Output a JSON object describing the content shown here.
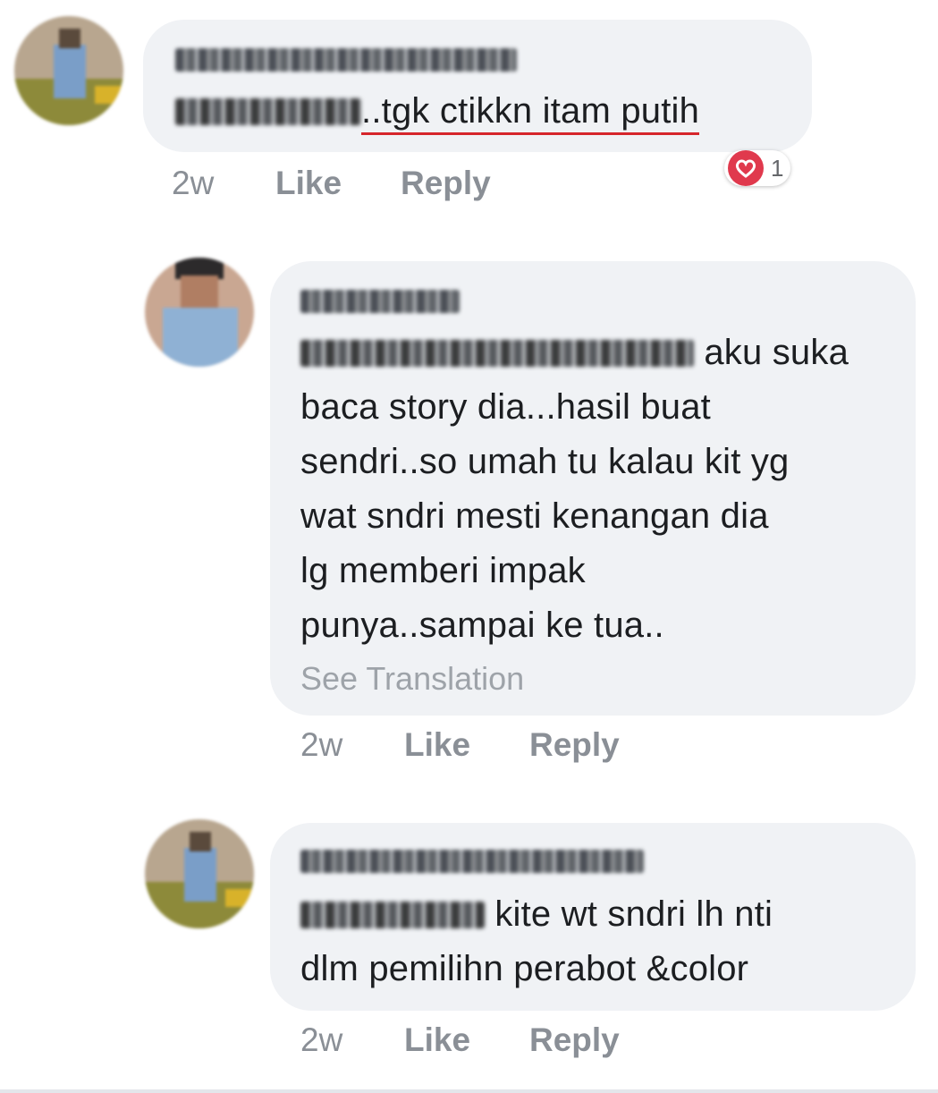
{
  "comments": [
    {
      "author_blurred": true,
      "mention_blurred": true,
      "text_lines": [
        "..tgk ctikkn itam putih"
      ],
      "see_translation": "",
      "time": "2w",
      "like_label": "Like",
      "reply_label": "Reply",
      "reaction": {
        "icon": "heart-icon",
        "count": "1",
        "color": "#e0394d"
      }
    },
    {
      "author_blurred": true,
      "mention_blurred": true,
      "text_lines": [
        " aku suka",
        "baca story dia...hasil buat",
        "sendri..so umah tu kalau kit yg",
        "wat sndri mesti kenangan dia",
        "lg memberi impak",
        "punya..sampai ke tua.."
      ],
      "see_translation": "See Translation",
      "time": "2w",
      "like_label": "Like",
      "reply_label": "Reply"
    },
    {
      "author_blurred": true,
      "mention_blurred": true,
      "text_lines": [
        " kite wt sndri lh nti",
        "dlm pemilihn perabot &color"
      ],
      "see_translation": "",
      "time": "2w",
      "like_label": "Like",
      "reply_label": "Reply"
    }
  ],
  "colors": {
    "bubble": "#f0f2f5",
    "action_text": "#8a8f96",
    "underline": "#d6262b",
    "heart": "#e0394d"
  }
}
